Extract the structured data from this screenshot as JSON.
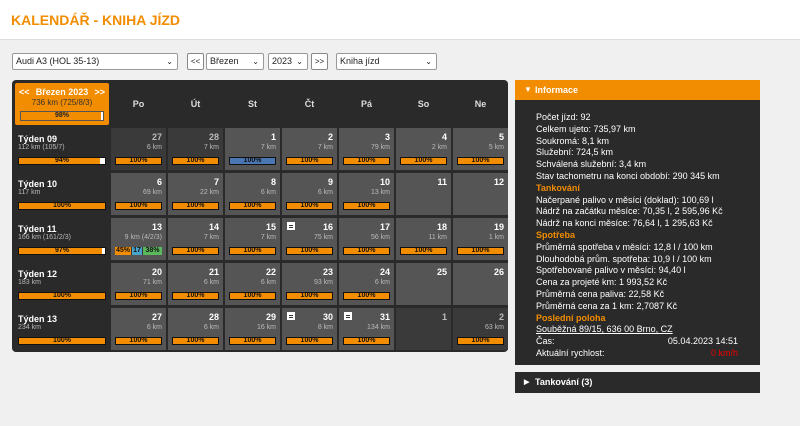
{
  "title": "KALENDÁŘ - KNIHA JÍZD",
  "controls": {
    "vehicle": "Audi A3 (HOL 35-13)",
    "prev": "<<",
    "month": "Březen",
    "year": "2023",
    "next": ">>",
    "view": "Kniha jízd"
  },
  "calendar": {
    "header": {
      "month": "Březen 2023",
      "prev": "<<",
      "next": ">>",
      "sub": "736 km (725/8/3)",
      "progress_label": "98%",
      "progress": 0.98
    },
    "days": [
      "Po",
      "Út",
      "St",
      "Čt",
      "Pá",
      "So",
      "Ne"
    ],
    "weeks": [
      {
        "name": "Týden 09",
        "sub": "112 km (105/7)",
        "bar": "94%",
        "progress": 0.94,
        "cells": [
          {
            "num": "27",
            "km": "6 km",
            "bar": "100%",
            "dim": true
          },
          {
            "num": "28",
            "km": "7 km",
            "bar": "100%",
            "dim": true
          },
          {
            "num": "1",
            "km": "7 km",
            "bar": "100%",
            "blue": true
          },
          {
            "num": "2",
            "km": "7 km",
            "bar": "100%"
          },
          {
            "num": "3",
            "km": "79 km",
            "bar": "100%"
          },
          {
            "num": "4",
            "km": "2 km",
            "bar": "100%"
          },
          {
            "num": "5",
            "km": "5 km",
            "bar": "100%"
          }
        ]
      },
      {
        "name": "Týden 10",
        "sub": "117 km",
        "bar": "100%",
        "progress": 1,
        "cells": [
          {
            "num": "6",
            "km": "69 km",
            "bar": "100%"
          },
          {
            "num": "7",
            "km": "22 km",
            "bar": "100%"
          },
          {
            "num": "8",
            "km": "6 km",
            "bar": "100%"
          },
          {
            "num": "9",
            "km": "6 km",
            "bar": "100%"
          },
          {
            "num": "10",
            "km": "13 km",
            "bar": "100%"
          },
          {
            "num": "11",
            "km": "",
            "bar": ""
          },
          {
            "num": "12",
            "km": "",
            "bar": ""
          }
        ]
      },
      {
        "name": "Týden 11",
        "sub": "166 km (161/2/3)",
        "bar": "97%",
        "progress": 0.97,
        "cells": [
          {
            "num": "13",
            "km": "9 km (4/2/3)",
            "bar": "",
            "split": [
              "45%",
              "17",
              "38%"
            ]
          },
          {
            "num": "14",
            "km": "7 km",
            "bar": "100%"
          },
          {
            "num": "15",
            "km": "7 km",
            "bar": "100%"
          },
          {
            "num": "16",
            "km": "75 km",
            "bar": "100%",
            "doc": true
          },
          {
            "num": "17",
            "km": "56 km",
            "bar": "100%"
          },
          {
            "num": "18",
            "km": "11 km",
            "bar": "100%"
          },
          {
            "num": "19",
            "km": "1 km",
            "bar": "100%"
          }
        ]
      },
      {
        "name": "Týden 12",
        "sub": "183 km",
        "bar": "100%",
        "progress": 1,
        "cells": [
          {
            "num": "20",
            "km": "71 km",
            "bar": "100%"
          },
          {
            "num": "21",
            "km": "6 km",
            "bar": "100%"
          },
          {
            "num": "22",
            "km": "6 km",
            "bar": "100%"
          },
          {
            "num": "23",
            "km": "93 km",
            "bar": "100%"
          },
          {
            "num": "24",
            "km": "6 km",
            "bar": "100%"
          },
          {
            "num": "25",
            "km": "",
            "bar": ""
          },
          {
            "num": "26",
            "km": "",
            "bar": ""
          }
        ]
      },
      {
        "name": "Týden 13",
        "sub": "234 km",
        "bar": "100%",
        "progress": 1,
        "cells": [
          {
            "num": "27",
            "km": "6 km",
            "bar": "100%"
          },
          {
            "num": "28",
            "km": "6 km",
            "bar": "100%"
          },
          {
            "num": "29",
            "km": "16 km",
            "bar": "100%"
          },
          {
            "num": "30",
            "km": "8 km",
            "bar": "100%",
            "doc": true
          },
          {
            "num": "31",
            "km": "134 km",
            "bar": "100%",
            "doc": true
          },
          {
            "num": "1",
            "km": "",
            "bar": "",
            "dim": true
          },
          {
            "num": "2",
            "km": "63 km",
            "bar": "100%",
            "dim": true
          }
        ]
      }
    ]
  },
  "info": {
    "title": "Informace",
    "lines": [
      {
        "t": "Počet jízd: 92"
      },
      {
        "t": "Celkem ujeto: 735,97 km"
      },
      {
        "t": "Soukromá: 8,1 km"
      },
      {
        "t": "Služební: 724,5 km"
      },
      {
        "t": "Schválená služební: 3,4 km"
      },
      {
        "t": "Stav tachometru na konci období: 290 345 km"
      },
      {
        "t": "Tankování",
        "cls": "or"
      },
      {
        "t": "Načerpané palivo v měsíci (doklad): 100,69 l"
      },
      {
        "t": "Nádrž na začátku měsíce: 70,35 l, 2 595,96 Kč"
      },
      {
        "t": "Nádrž na konci měsíce: 76,64 l, 1 295,63 Kč"
      },
      {
        "t": "Spotřeba",
        "cls": "or"
      },
      {
        "t": "Průměrná spotřeba v měsíci: 12,8 l / 100 km"
      },
      {
        "t": "Dlouhodobá prům. spotřeba: 10,9 l / 100 km"
      },
      {
        "t": "Spotřebované palivo v měsíci: 94,40 l"
      },
      {
        "t": "Cena za projeté km: 1 993,52 Kč"
      },
      {
        "t": "Průměrná cena paliva: 22,58 Kč"
      },
      {
        "t": "Průměrná cena za 1 km: 2,7087 Kč"
      },
      {
        "t": "Poslední poloha",
        "cls": "or"
      },
      {
        "t": "Souběžná 89/15, 636 00 Brno, CZ",
        "cls": "link"
      },
      {
        "t": "Čas:",
        "val": "05.04.2023 14:51"
      },
      {
        "t": "Aktuální rychlost:",
        "val": "0 km/h",
        "valcls": "red"
      }
    ]
  },
  "tankovani": {
    "title": "Tankování (3)"
  },
  "colors": {
    "accent": "#f28c00",
    "dark": "#2a2a2a",
    "cell": "#555555",
    "blue": "#4a76b4",
    "speed": "#e00000"
  }
}
